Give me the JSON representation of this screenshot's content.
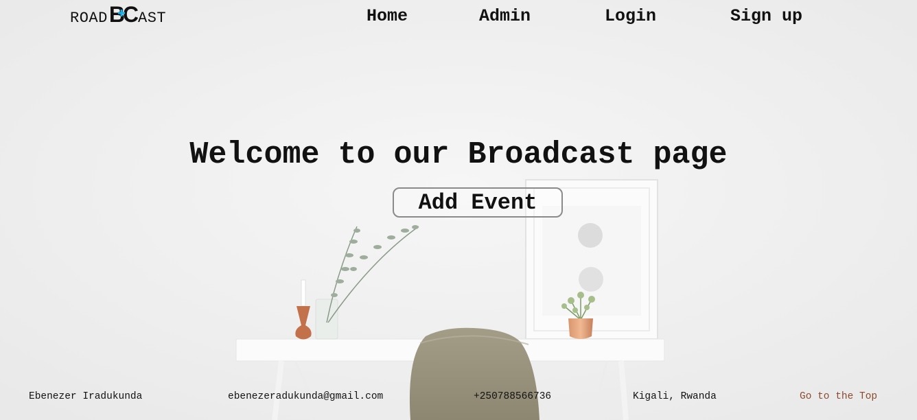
{
  "header": {
    "logo": {
      "left_text": "ROAD",
      "mark_text": "BC",
      "right_text": "AST",
      "accent_color": "#1ab0e8"
    },
    "nav": [
      {
        "id": "home",
        "label": "Home"
      },
      {
        "id": "admin",
        "label": "Admin"
      },
      {
        "id": "login",
        "label": "Login"
      },
      {
        "id": "signup",
        "label": "Sign up"
      }
    ]
  },
  "hero": {
    "title": "Welcome to our Broadcast page",
    "add_event_label": "Add Event"
  },
  "footer": {
    "name": "Ebenezer Iradukunda",
    "email": "ebenezeradukunda@gmail.com",
    "phone": "+250788566736",
    "location": "Kigali, Rwanda",
    "top_link": "Go to the Top",
    "top_link_color": "#8b4a2b"
  }
}
